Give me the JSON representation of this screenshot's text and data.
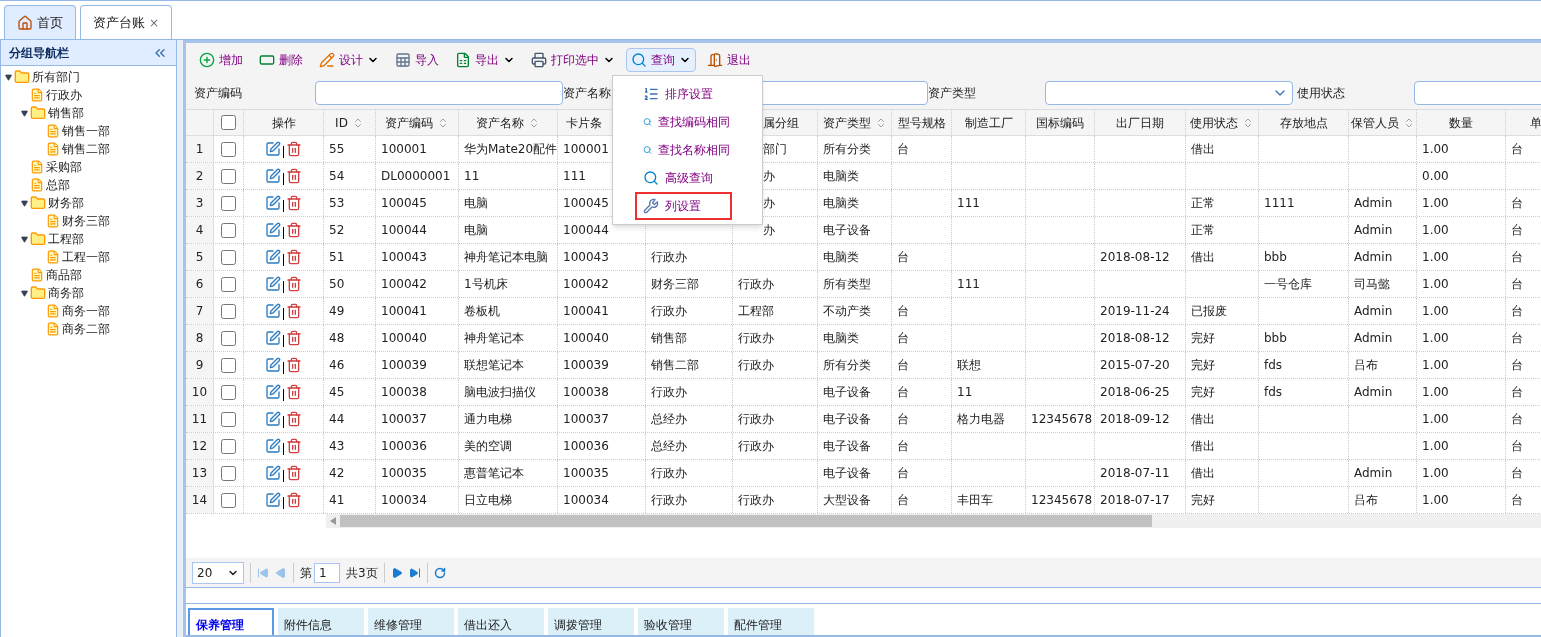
{
  "tabs": [
    {
      "label": "首页",
      "selected": false,
      "closable": false
    },
    {
      "label": "资产台账",
      "selected": true,
      "closable": true,
      "close_glyph": "×"
    }
  ],
  "sidebar": {
    "title": "分组导航栏",
    "tree": [
      {
        "label": "所有部门",
        "expanded": true,
        "children": [
          {
            "label": "行政办"
          },
          {
            "label": "销售部",
            "expanded": true,
            "children": [
              {
                "label": "销售一部"
              },
              {
                "label": "销售二部"
              }
            ]
          },
          {
            "label": "采购部"
          },
          {
            "label": "总部"
          },
          {
            "label": "财务部",
            "expanded": true,
            "children": [
              {
                "label": "财务三部"
              }
            ]
          },
          {
            "label": "工程部",
            "expanded": true,
            "children": [
              {
                "label": "工程一部"
              }
            ]
          },
          {
            "label": "商品部"
          },
          {
            "label": "商务部",
            "expanded": true,
            "children": [
              {
                "label": "商务一部"
              },
              {
                "label": "商务二部"
              }
            ]
          }
        ]
      }
    ]
  },
  "toolbar": [
    {
      "label": "增加",
      "dropdown": false,
      "active": false
    },
    {
      "label": "删除",
      "dropdown": false,
      "active": false
    },
    {
      "label": "设计",
      "dropdown": true,
      "active": false
    },
    {
      "label": "导入",
      "dropdown": false,
      "active": false
    },
    {
      "label": "导出",
      "dropdown": true,
      "active": false
    },
    {
      "label": "打印选中",
      "dropdown": true,
      "active": false
    },
    {
      "label": "查询",
      "dropdown": true,
      "active": true
    },
    {
      "label": "退出",
      "dropdown": false,
      "active": false
    }
  ],
  "query_menu": [
    {
      "label": "排序设置",
      "highlighted": false
    },
    {
      "label": "查找编码相同",
      "highlighted": false
    },
    {
      "label": "查找名称相同",
      "highlighted": false
    },
    {
      "label": "高级查询",
      "highlighted": false
    },
    {
      "label": "列设置",
      "highlighted": true
    }
  ],
  "filters": [
    {
      "label": "资产编码",
      "kind": "text"
    },
    {
      "label": "资产名称",
      "kind": "text"
    },
    {
      "label": "资产类型",
      "kind": "select"
    },
    {
      "label": "使用状态",
      "kind": "text"
    }
  ],
  "table": {
    "select_all_checked": false,
    "columns": [
      {
        "label": "操作",
        "sortable": false
      },
      {
        "label": "ID",
        "sortable": true
      },
      {
        "label": "资产编码",
        "sortable": true
      },
      {
        "label": "资产名称",
        "sortable": true
      },
      {
        "label": "卡片条",
        "sortable": false
      },
      {},
      {
        "label": "属分组",
        "sortable": false
      },
      {
        "label": "资产类型",
        "sortable": true
      },
      {
        "label": "型号规格",
        "sortable": false
      },
      {
        "label": "制造工厂",
        "sortable": false
      },
      {
        "label": "国标编码",
        "sortable": false
      },
      {
        "label": "出厂日期",
        "sortable": false
      },
      {
        "label": "使用状态",
        "sortable": true
      },
      {
        "label": "存放地点",
        "sortable": false
      },
      {
        "label": "保管人员",
        "sortable": true
      },
      {
        "label": "数量",
        "sortable": false
      },
      {
        "label": "单",
        "sortable": false
      }
    ],
    "rows": [
      {
        "n": "1",
        "checked": false,
        "cells": [
          "",
          "55",
          "100001",
          "华为Mate20配件",
          "100001",
          null,
          "部门",
          "所有分类",
          "台",
          null,
          null,
          null,
          "借出",
          null,
          null,
          "1.00",
          "台"
        ]
      },
      {
        "n": "2",
        "checked": false,
        "cells": [
          "",
          "54",
          "DL0000001",
          "11",
          "111",
          null,
          "办",
          "电脑类",
          null,
          null,
          null,
          null,
          null,
          null,
          null,
          "0.00",
          null
        ]
      },
      {
        "n": "3",
        "checked": false,
        "cells": [
          "",
          "53",
          "100045",
          "电脑",
          "100045",
          null,
          "办",
          "电脑类",
          null,
          "111",
          null,
          null,
          "正常",
          "1111",
          "Admin",
          "1.00",
          "台"
        ]
      },
      {
        "n": "4",
        "checked": false,
        "cells": [
          "",
          "52",
          "100044",
          "电脑",
          "100044",
          null,
          "办",
          "电子设备",
          null,
          null,
          null,
          null,
          "正常",
          null,
          "Admin",
          "1.00",
          "台"
        ]
      },
      {
        "n": "5",
        "checked": false,
        "cells": [
          "",
          "51",
          "100043",
          "神舟笔记本电脑",
          "100043",
          "行政办",
          null,
          "电脑类",
          "台",
          null,
          null,
          "2018-08-12",
          "借出",
          "bbb",
          "Admin",
          "1.00",
          "台"
        ]
      },
      {
        "n": "6",
        "checked": false,
        "cells": [
          "",
          "50",
          "100042",
          "1号机床",
          "100042",
          "财务三部",
          "行政办",
          "所有类型",
          null,
          "111",
          null,
          null,
          null,
          "一号仓库",
          "司马懿",
          "1.00",
          "台"
        ]
      },
      {
        "n": "7",
        "checked": false,
        "cells": [
          "",
          "49",
          "100041",
          "卷板机",
          "100041",
          "行政办",
          "工程部",
          "不动产类",
          "台",
          null,
          null,
          "2019-11-24",
          "已报废",
          null,
          "Admin",
          "1.00",
          "台"
        ]
      },
      {
        "n": "8",
        "checked": false,
        "cells": [
          "",
          "48",
          "100040",
          "神舟笔记本",
          "100040",
          "销售部",
          "行政办",
          "电脑类",
          "台",
          null,
          null,
          "2018-08-12",
          "完好",
          "bbb",
          "Admin",
          "1.00",
          "台"
        ]
      },
      {
        "n": "9",
        "checked": false,
        "cells": [
          "",
          "46",
          "100039",
          "联想笔记本",
          "100039",
          "销售二部",
          "行政办",
          "所有分类",
          "台",
          "联想",
          null,
          "2015-07-20",
          "完好",
          "fds",
          "吕布",
          "1.00",
          "台"
        ]
      },
      {
        "n": "10",
        "checked": false,
        "cells": [
          "",
          "45",
          "100038",
          "脑电波扫描仪",
          "100038",
          "行政办",
          null,
          "电子设备",
          "台",
          "11",
          null,
          "2018-06-25",
          "完好",
          "fds",
          "Admin",
          "1.00",
          "台"
        ]
      },
      {
        "n": "11",
        "checked": false,
        "cells": [
          "",
          "44",
          "100037",
          "通力电梯",
          "100037",
          "总经办",
          "行政办",
          "电子设备",
          "台",
          "格力电器",
          "12345678",
          "2018-09-12",
          "借出",
          null,
          null,
          "1.00",
          "台"
        ]
      },
      {
        "n": "12",
        "checked": false,
        "cells": [
          "",
          "43",
          "100036",
          "美的空调",
          "100036",
          "总经办",
          "行政办",
          "电子设备",
          "台",
          null,
          null,
          null,
          "借出",
          null,
          null,
          "1.00",
          "台"
        ]
      },
      {
        "n": "13",
        "checked": false,
        "cells": [
          "",
          "42",
          "100035",
          "惠普笔记本",
          "100035",
          "行政办",
          null,
          "电子设备",
          "台",
          null,
          null,
          "2018-07-11",
          "借出",
          null,
          "Admin",
          "1.00",
          "台"
        ]
      },
      {
        "n": "14",
        "checked": false,
        "cells": [
          "",
          "41",
          "100034",
          "日立电梯",
          "100034",
          "行政办",
          "行政办",
          "大型设备",
          "台",
          "丰田车",
          "12345678",
          "2018-07-17",
          "完好",
          null,
          "吕布",
          "1.00",
          "台"
        ]
      }
    ]
  },
  "pager": {
    "page_size": "20",
    "page_prefix": "第",
    "page": "1",
    "total": "共3页"
  },
  "bottom_tabs": [
    {
      "label": "保养管理",
      "selected": true
    },
    {
      "label": "附件信息",
      "selected": false
    },
    {
      "label": "维修管理",
      "selected": false
    },
    {
      "label": "借出还入",
      "selected": false
    },
    {
      "label": "调拨管理",
      "selected": false
    },
    {
      "label": "验收管理",
      "selected": false
    },
    {
      "label": "配件管理",
      "selected": false
    }
  ]
}
